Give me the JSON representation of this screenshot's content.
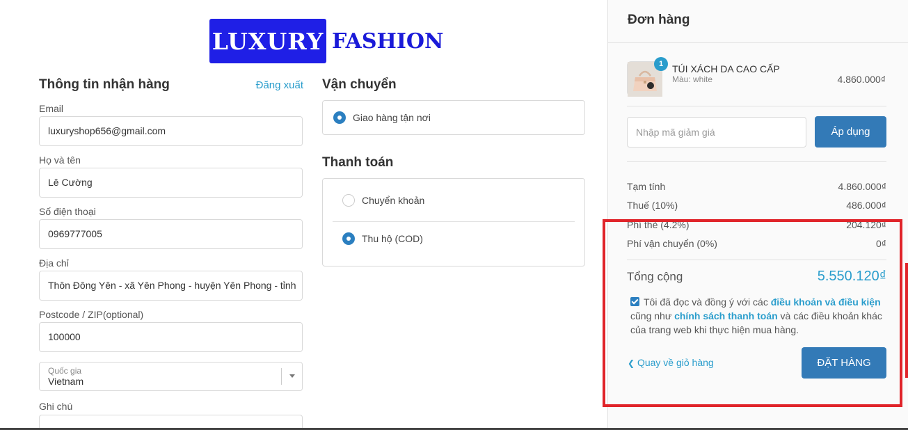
{
  "logo": {
    "box_text": "LUXURY",
    "side_text": "FASHION",
    "box_color": "#1f1fe6"
  },
  "shipping_info": {
    "title": "Thông tin nhận hàng",
    "logout_link": "Đăng xuất",
    "email": {
      "label": "Email",
      "value": "luxuryshop656@gmail.com"
    },
    "fullname": {
      "label": "Họ và tên",
      "value": "Lê Cường"
    },
    "phone": {
      "label": "Số điện thoại",
      "value": "0969777005"
    },
    "address": {
      "label": "Địa chỉ",
      "value": "Thôn Đông Yên - xã Yên Phong - huyện Yên Phong - tỉnh"
    },
    "postcode": {
      "label": "Postcode / ZIP(optional)",
      "value": "100000"
    },
    "country": {
      "label": "Quốc gia",
      "value": "Vietnam"
    },
    "note": {
      "label": "Ghi chú"
    }
  },
  "delivery": {
    "title": "Vận chuyển",
    "option": "Giao hàng tận nơi"
  },
  "payment": {
    "title": "Thanh toán",
    "options": [
      "Chuyển khoản",
      "Thu hộ (COD)"
    ],
    "selected": "Thu hộ (COD)"
  },
  "order": {
    "title": "Đơn hàng",
    "item": {
      "quantity": "1",
      "name": "TÚI XÁCH DA CAO CẤP",
      "variant": "Màu: white",
      "price": "4.860.000₫"
    },
    "coupon_placeholder": "Nhập mã giảm giá",
    "apply_label": "Áp dụng",
    "lines": [
      {
        "label": "Tạm tính",
        "value": "4.860.000₫"
      },
      {
        "label": "Thuế (10%)",
        "value": "486.000₫"
      },
      {
        "label": "Phí thẻ (4.2%)",
        "value": "204.120₫"
      },
      {
        "label": "Phí vận chuyển (0%)",
        "value": "0₫"
      }
    ],
    "total_label": "Tổng cộng",
    "total_value": "5.550.120₫",
    "agree": {
      "part1": "Tôi đã đọc và đồng ý với các ",
      "terms": "điều khoản và điều kiện",
      "part2": " cũng như ",
      "payment_policy": "chính sách thanh toán",
      "part3": " và các điều khoản khác của trang web khi thực hiện mua hàng."
    },
    "back_label": "Quay về giỏ hàng",
    "order_button": "ĐẶT HÀNG"
  },
  "colors": {
    "accent": "#2a9dcc",
    "button": "#337ab7",
    "highlight": "#e0242a"
  }
}
